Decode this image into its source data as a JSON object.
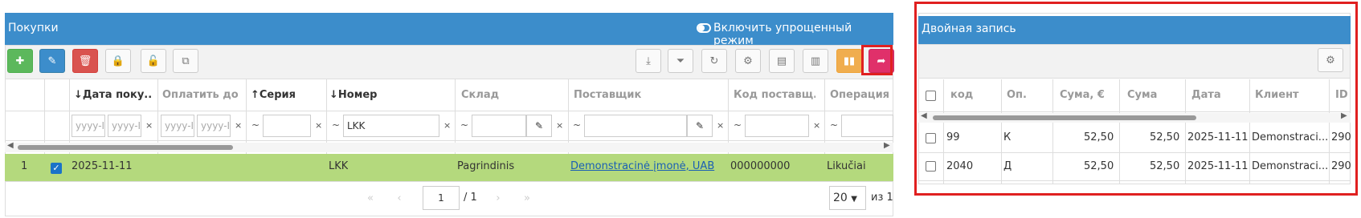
{
  "left_panel": {
    "title": "Покупки",
    "simple_mode_label": "Включить упрощенный режим",
    "columns": [
      {
        "label": "↓Дата поку...",
        "muted": false
      },
      {
        "label": "Оплатить до",
        "muted": true
      },
      {
        "label": "↑Серия",
        "muted": false
      },
      {
        "label": "↓Номер",
        "muted": false
      },
      {
        "label": "Склад",
        "muted": true
      },
      {
        "label": "Поставщик",
        "muted": true
      },
      {
        "label": "Код поставщ...",
        "muted": true
      },
      {
        "label": "Операция",
        "muted": true
      }
    ],
    "filters": {
      "date_from_placeholder": "yyyy-I",
      "date_to_placeholder": "yyyy-I",
      "pay_from_placeholder": "yyyy-I",
      "pay_to_placeholder": "yyyy-I",
      "tilde": "~",
      "clear": "×",
      "number_value": "LKK"
    },
    "row": {
      "index": "1",
      "date": "2025-11-11",
      "number": "LKK",
      "warehouse": "Pagrindinis",
      "supplier": "Demonstracinė įmonė, UAB",
      "supplier_code": "000000000",
      "operation": "Likučiai"
    },
    "pagination": {
      "page": "1",
      "total": "/ 1",
      "page_size": "20",
      "of_label": "из 1"
    }
  },
  "right_panel": {
    "title": "Двойная запись",
    "columns": [
      "код",
      "Оп.",
      "Сума, €",
      "Сума",
      "Дата",
      "Клиент",
      "ID"
    ],
    "rows": [
      {
        "code": "99",
        "op": "К",
        "sum_eur": "52,50",
        "sum": "52,50",
        "date": "2025-11-11",
        "client": "Demonstraci...",
        "id": "290"
      },
      {
        "code": "2040",
        "op": "Д",
        "sum_eur": "52,50",
        "sum": "52,50",
        "date": "2025-11-11",
        "client": "Demonstraci...",
        "id": "290"
      }
    ]
  },
  "colors": {
    "header": "#3c8dcb",
    "selected_row": "#b4d97d",
    "highlight": "#e02020"
  }
}
